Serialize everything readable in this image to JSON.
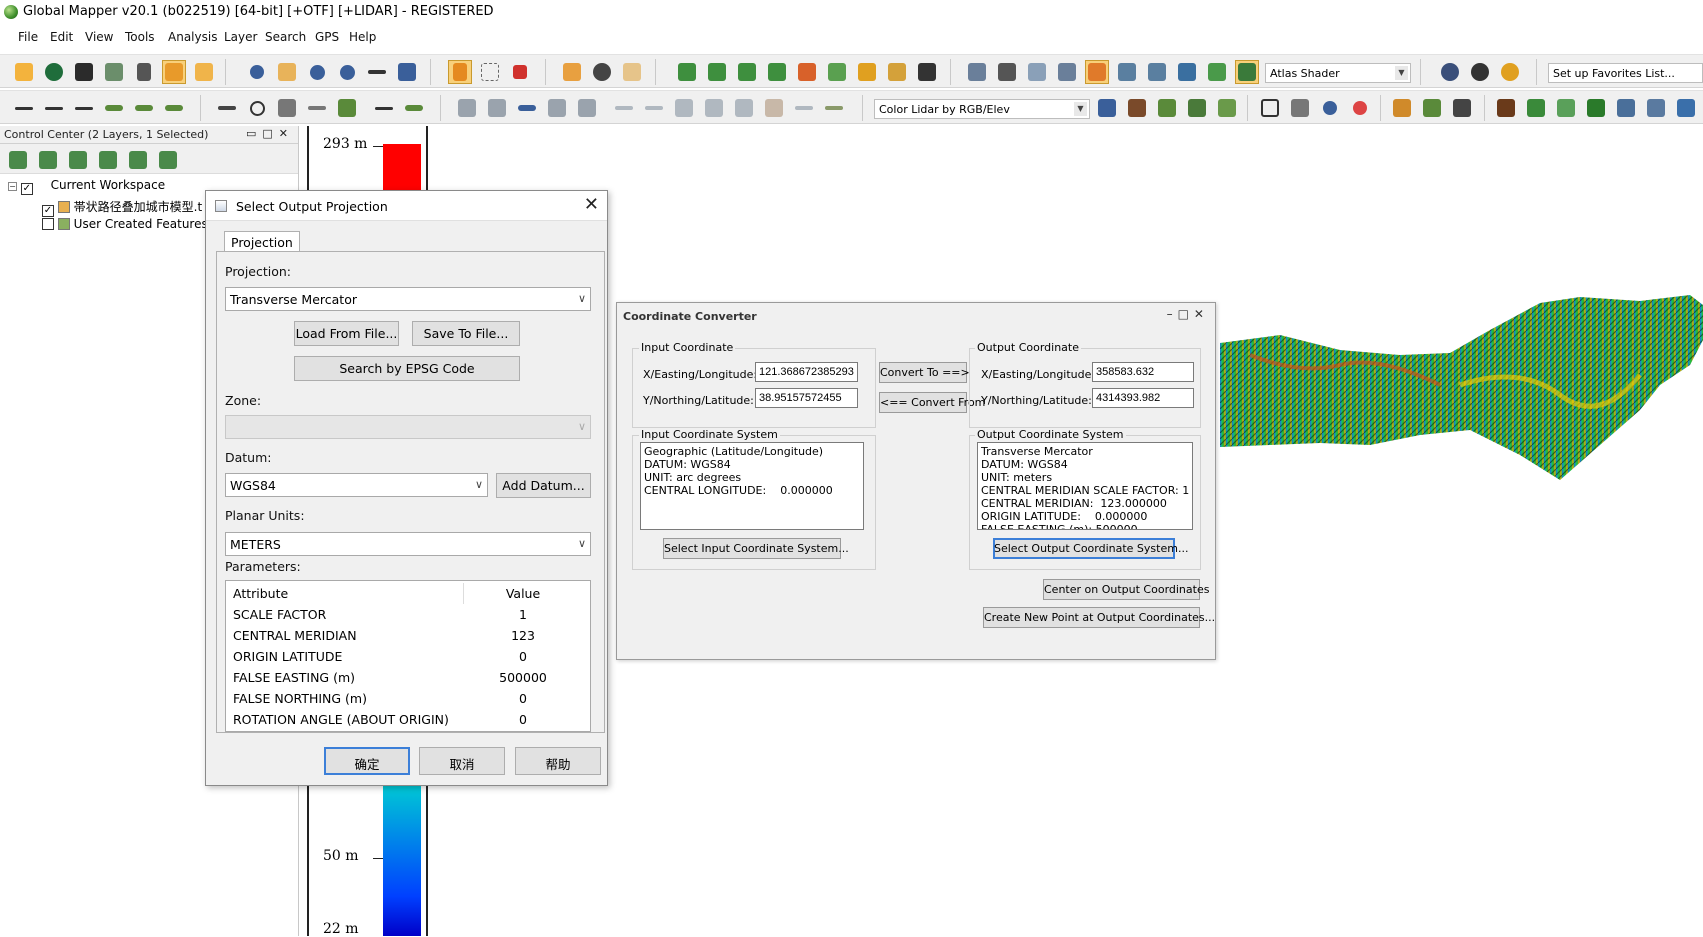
{
  "window": {
    "title": "Global Mapper v20.1 (b022519) [64-bit] [+OTF] [+LIDAR] - REGISTERED"
  },
  "menu": [
    "File",
    "Edit",
    "View",
    "Tools",
    "Analysis",
    "Layer",
    "Search",
    "GPS",
    "Help"
  ],
  "toolbar": {
    "shader_combo": "Atlas Shader",
    "favorites_combo": "Set up Favorites List...",
    "lidar_combo": "Color Lidar by RGB/Elev"
  },
  "control_center": {
    "header": "Control Center (2 Layers, 1 Selected)",
    "workspace": "Current Workspace",
    "layers": [
      {
        "label": "帯状路径叠加城市模型.t",
        "checked": true
      },
      {
        "label": "User Created Features",
        "checked": false
      }
    ]
  },
  "legend": {
    "top_label": "293 m",
    "mid_label": "50 m",
    "bottom_label": "22 m"
  },
  "projection_dialog": {
    "title": "Select Output Projection",
    "tab": "Projection",
    "projection_label": "Projection:",
    "projection_value": "Transverse Mercator",
    "load_button": "Load From File...",
    "save_button": "Save To File...",
    "epsg_button": "Search by EPSG Code",
    "zone_label": "Zone:",
    "zone_value": "",
    "datum_label": "Datum:",
    "datum_value": "WGS84",
    "add_datum_button": "Add Datum...",
    "units_label": "Planar Units:",
    "units_value": "METERS",
    "params_label": "Parameters:",
    "col_attribute": "Attribute",
    "col_value": "Value",
    "params": [
      {
        "attribute": "SCALE FACTOR",
        "value": "1"
      },
      {
        "attribute": "CENTRAL MERIDIAN",
        "value": "123"
      },
      {
        "attribute": "ORIGIN LATITUDE",
        "value": "0"
      },
      {
        "attribute": "FALSE EASTING (m)",
        "value": "500000"
      },
      {
        "attribute": "FALSE NORTHING (m)",
        "value": "0"
      },
      {
        "attribute": "ROTATION ANGLE (ABOUT ORIGIN)",
        "value": "0"
      }
    ],
    "ok_button": "确定",
    "cancel_button": "取消",
    "help_button": "帮助"
  },
  "converter": {
    "title": "Coordinate Converter",
    "input_group": "Input Coordinate",
    "output_group": "Output Coordinate",
    "x_label": "X/Easting/Longitude:",
    "y_label": "Y/Northing/Latitude:",
    "input_x": "121.368672385293",
    "input_y": "38.95157572455",
    "output_x": "358583.632",
    "output_y": "4314393.982",
    "convert_to": "Convert To ==>",
    "convert_from": "<== Convert From",
    "input_system_group": "Input Coordinate System",
    "output_system_group": "Output Coordinate System",
    "input_system_text": "Geographic (Latitude/Longitude)\nDATUM: WGS84\nUNIT: arc degrees\nCENTRAL LONGITUDE:    0.000000",
    "output_system_text": "Transverse Mercator\nDATUM: WGS84\nUNIT: meters\nCENTRAL MERIDIAN SCALE FACTOR: 1\nCENTRAL MERIDIAN:  123.000000\nORIGIN LATITUDE:    0.000000\nFALSE EASTING (m): 500000",
    "select_input": "Select Input Coordinate System...",
    "select_output": "Select Output Coordinate System...",
    "center_output": "Center on Output Coordinates",
    "create_point": "Create New Point at Output Coordinates..."
  }
}
